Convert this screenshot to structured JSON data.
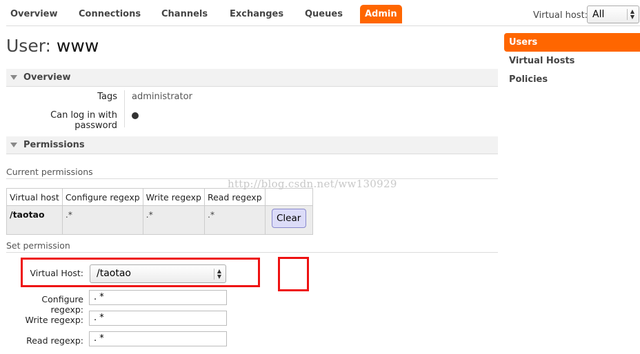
{
  "nav": {
    "items": [
      "Overview",
      "Connections",
      "Channels",
      "Exchanges",
      "Queues",
      "Admin"
    ],
    "active": "Admin",
    "vhost_label": "Virtual host:",
    "vhost_value": "All"
  },
  "sidebar": {
    "items": [
      "Users",
      "Virtual Hosts",
      "Policies"
    ],
    "active": "Users"
  },
  "page": {
    "title_prefix": "User:",
    "title_name": "www"
  },
  "overview": {
    "header": "Overview",
    "tags_label": "Tags",
    "tags_value": "administrator",
    "login_label": "Can log in with password"
  },
  "permissions": {
    "header": "Permissions",
    "current_heading": "Current permissions",
    "columns": [
      "Virtual host",
      "Configure regexp",
      "Write regexp",
      "Read regexp"
    ],
    "rows": [
      {
        "vhost": "/taotao",
        "configure": ".*",
        "write": ".*",
        "read": ".*",
        "action": "Clear"
      }
    ]
  },
  "set_permission": {
    "heading": "Set permission",
    "vhost_label": "Virtual Host:",
    "vhost_value": "/taotao",
    "configure_label": "Configure regexp:",
    "configure_value": ". *",
    "write_label": "Write regexp:",
    "write_value": ". *",
    "read_label": "Read regexp:",
    "read_value": ". *"
  },
  "watermark": "http://blog.csdn.net/ww130929",
  "colors": {
    "accent": "#ff6600",
    "highlight": "#ee1111",
    "button": "#dcdcf8"
  }
}
